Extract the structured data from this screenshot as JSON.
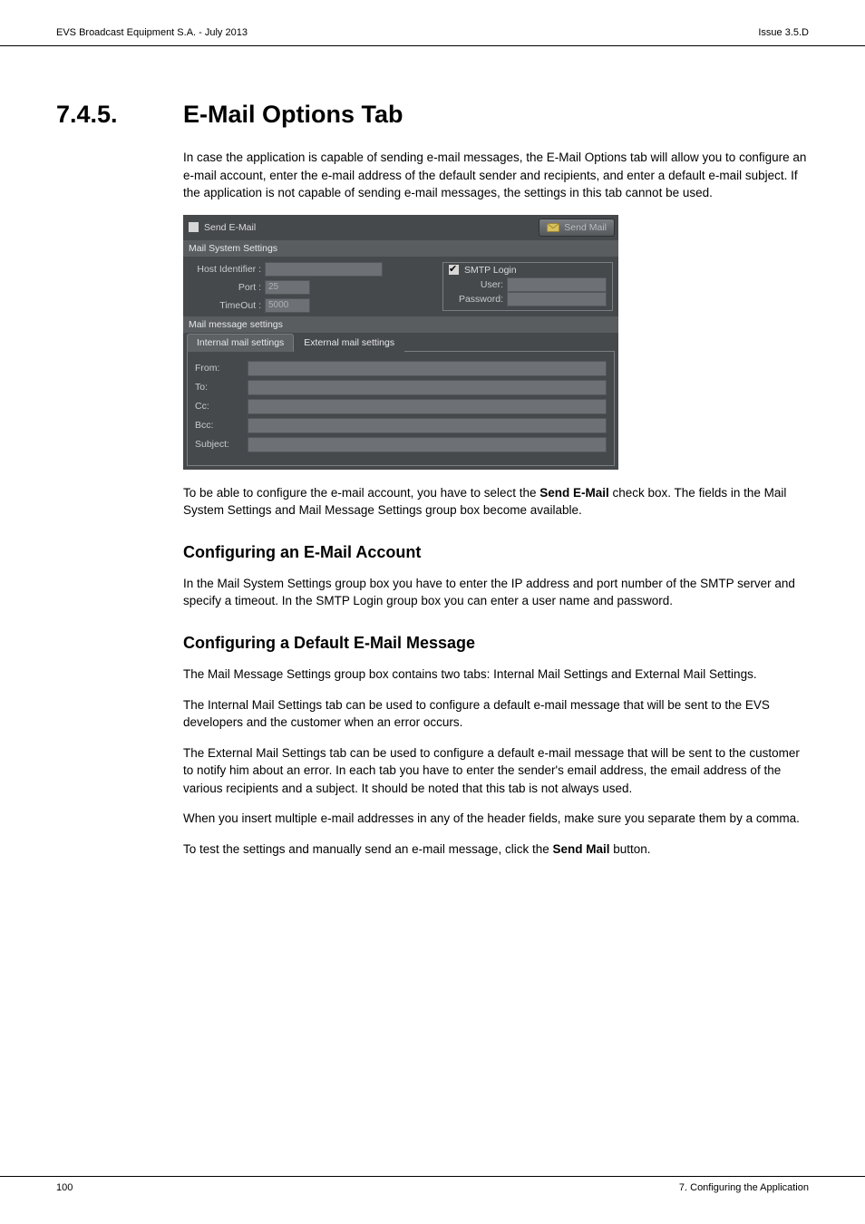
{
  "header": {
    "left": "EVS Broadcast Equipment S.A. - July 2013",
    "right": "Issue 3.5.D"
  },
  "section": {
    "number": "7.4.5.",
    "title": "E-Mail Options Tab"
  },
  "intro": "In case the application is capable of sending e-mail messages, the E-Mail Options tab will allow you to configure an e-mail account, enter the e-mail address of the default sender and recipients, and enter a default e-mail subject. If the application is not capable of sending e-mail messages, the settings in this tab cannot be used.",
  "shot": {
    "send_email_label": "Send E-Mail",
    "send_mail_btn": "Send Mail",
    "mail_system_settings": "Mail System Settings",
    "host_identifier": "Host Identifier :",
    "port_label": "Port :",
    "port_value": "25",
    "timeout_label": "TimeOut :",
    "timeout_value": "5000",
    "smtp_login": "SMTP Login",
    "user_label": "User:",
    "password_label": "Password:",
    "mail_message_settings": "Mail message settings",
    "tab_internal": "Internal mail settings",
    "tab_external": "External mail settings",
    "from": "From:",
    "to": "To:",
    "cc": "Cc:",
    "bcc": "Bcc:",
    "subject": "Subject:"
  },
  "after_shot_1a": "To be able to configure the e-mail account, you have to select the ",
  "after_shot_1b": "Send E-Mail",
  "after_shot_1c": " check box. The fields in the Mail System Settings and Mail Message Settings group box become available.",
  "h2a": "Configuring an E-Mail Account",
  "p2": "In the Mail System Settings group box you have to enter the IP address and port number of the SMTP server and specify a timeout. In the SMTP Login group box you can enter a user name and password.",
  "h2b": "Configuring a Default E-Mail Message",
  "p3": "The Mail Message Settings group box contains two tabs: Internal Mail Settings and External Mail Settings.",
  "p4": "The Internal Mail Settings tab can be used to configure a default e-mail message that will be sent to the EVS developers and the customer when an error occurs.",
  "p5": "The External Mail Settings tab can be used to configure a default e-mail message that will be sent to the customer to notify him about an error. In each tab you have to enter the sender's email address, the email address of the various recipients and a subject. It should be noted that this tab is not always used.",
  "p6": "When you insert multiple e-mail addresses in any of the header fields, make sure you separate them by a comma.",
  "p7a": "To test the settings and manually send an e-mail message, click the ",
  "p7b": "Send Mail",
  "p7c": " button.",
  "footer": {
    "page": "100",
    "right": "7. Configuring the Application"
  }
}
